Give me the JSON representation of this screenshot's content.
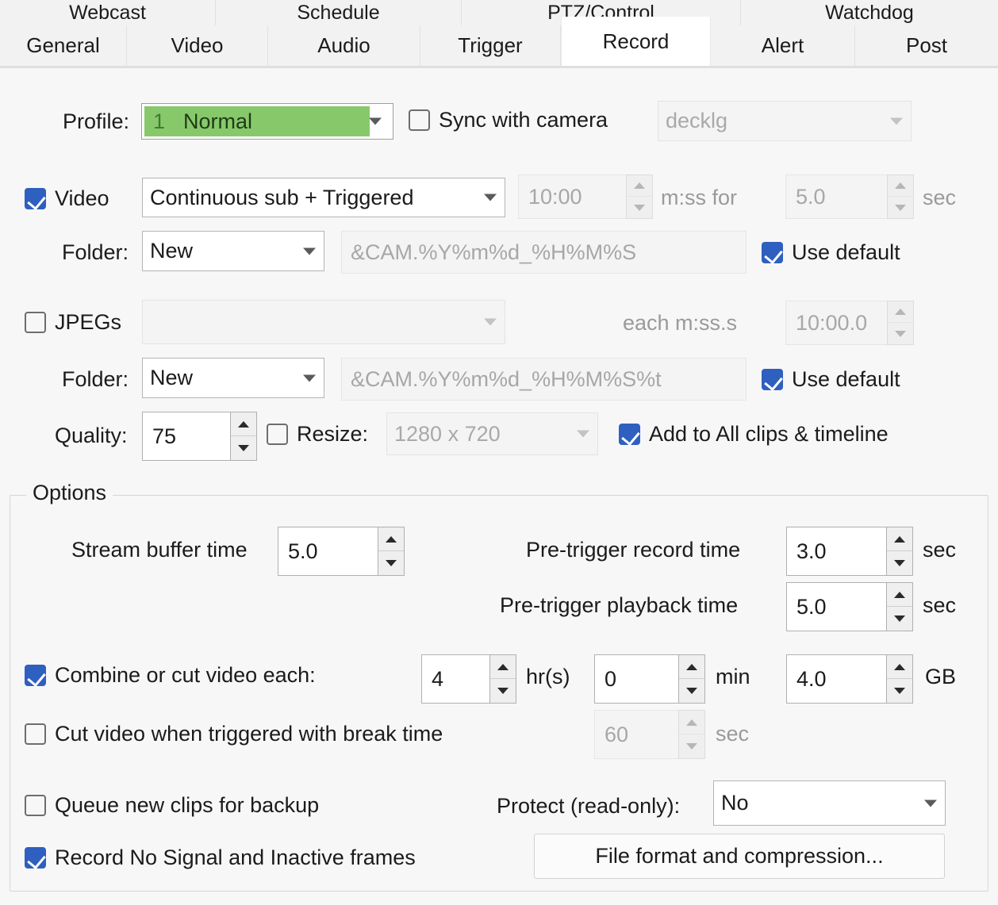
{
  "window": {
    "title": "Record"
  },
  "tabs_top": [
    {
      "label": "Webcast",
      "active": false
    },
    {
      "label": "Schedule",
      "active": false
    },
    {
      "label": "PTZ/Control",
      "active": false
    },
    {
      "label": "Watchdog",
      "active": false
    }
  ],
  "tabs_main": [
    {
      "label": "General",
      "active": false
    },
    {
      "label": "Video",
      "active": false
    },
    {
      "label": "Audio",
      "active": false
    },
    {
      "label": "Trigger",
      "active": false
    },
    {
      "label": "Record",
      "active": true
    },
    {
      "label": "Alert",
      "active": false
    },
    {
      "label": "Post",
      "active": false
    }
  ],
  "colors": {
    "accent_checkbox": "#2f5fbf",
    "profile_green": "#87c96a",
    "panel_bg": "#f7f7f7",
    "active_tab_bg": "#ffffff"
  },
  "profile_row": {
    "label": "Profile:",
    "profile_number": "1",
    "profile_name": "Normal",
    "sync_with_camera": {
      "label": "Sync with camera",
      "checked": false
    },
    "camera_select": {
      "value": "decklg",
      "enabled": false
    }
  },
  "video_row": {
    "checkbox": {
      "label": "Video",
      "checked": true
    },
    "mode": "Continuous sub + Triggered",
    "interval": {
      "value": "10:00",
      "enabled": false
    },
    "interval_unit": "m:ss for",
    "duration": {
      "value": "5.0",
      "enabled": false
    },
    "duration_unit": "sec"
  },
  "video_folder_row": {
    "label": "Folder:",
    "mode": "New",
    "path": "&CAM.%Y%m%d_%H%M%S",
    "use_default": {
      "label": "Use default",
      "checked": true
    }
  },
  "jpegs_row": {
    "checkbox": {
      "label": "JPEGs",
      "checked": false
    },
    "mode": "",
    "interval_unit": "each m:ss.s",
    "interval": {
      "value": "10:00.0",
      "enabled": false
    }
  },
  "jpegs_folder_row": {
    "label": "Folder:",
    "mode": "New",
    "path": "&CAM.%Y%m%d_%H%M%S%t",
    "use_default": {
      "label": "Use default",
      "checked": true
    }
  },
  "quality_row": {
    "label": "Quality:",
    "value": "75",
    "resize": {
      "label": "Resize:",
      "checked": false
    },
    "resize_value": {
      "value": "1280 x 720",
      "enabled": false
    },
    "add_to_all": {
      "label": "Add  to All clips & timeline",
      "checked": true
    }
  },
  "options": {
    "title": "Options",
    "stream_buffer": {
      "label": "Stream buffer time",
      "value": "5.0"
    },
    "pre_trigger_record": {
      "label": "Pre-trigger record time",
      "value": "3.0",
      "unit": "sec"
    },
    "pre_trigger_playback": {
      "label": "Pre-trigger playback time",
      "value": "5.0",
      "unit": "sec"
    },
    "combine_cut": {
      "label": "Combine or cut video each:",
      "checked": true,
      "hours": "4",
      "hours_unit": "hr(s)",
      "minutes": "0",
      "minutes_unit": "min",
      "size": "4.0",
      "size_unit": "GB"
    },
    "cut_when_triggered": {
      "label": "Cut video when triggered with break time",
      "checked": false,
      "break_time": "60",
      "break_unit": "sec"
    },
    "queue_backup": {
      "label": "Queue new clips for backup",
      "checked": false
    },
    "protect": {
      "label": "Protect (read-only):",
      "value": "No"
    },
    "record_no_signal": {
      "label": "Record No Signal and Inactive frames",
      "checked": true
    },
    "file_format_button": "File format and compression..."
  }
}
